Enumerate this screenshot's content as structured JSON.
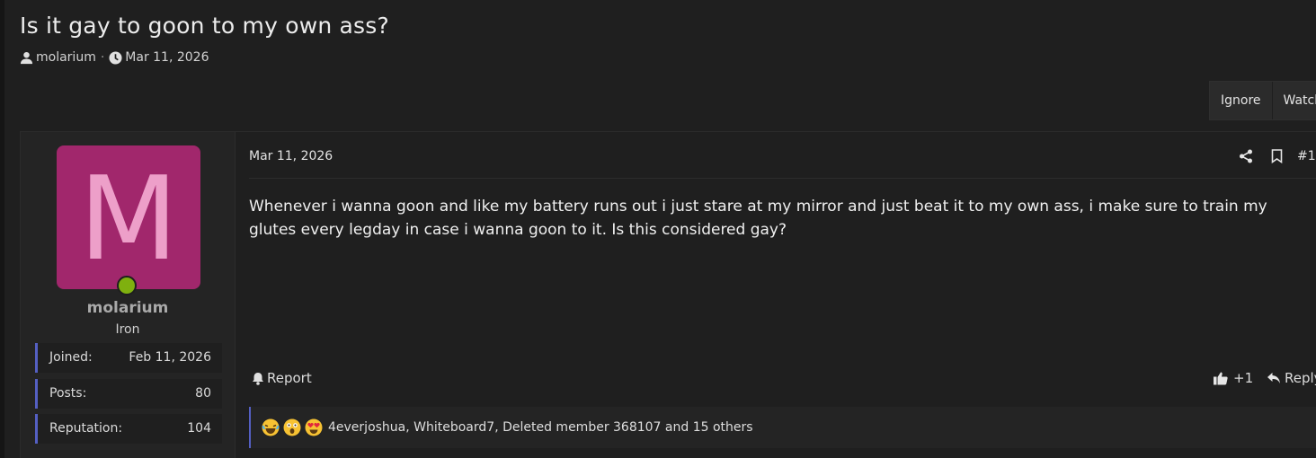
{
  "thread": {
    "title": "Is it gay to goon to my own ass?",
    "author": "molarium",
    "separator": "·",
    "date": "Mar 11, 2026",
    "actions": [
      "Ignore",
      "Watch"
    ]
  },
  "post": {
    "date": "Mar 11, 2026",
    "number": "#1",
    "body": "Whenever i wanna goon and like my battery runs out i just stare at my mirror and just beat it to my own ass, i make sure to train my glutes every legday in case i wanna goon to it. Is this considered gay?",
    "report_label": "Report",
    "like_count": "+1",
    "reply_label": "Reply",
    "reactions_text": "4everjoshua, Whiteboard7, Deleted member 368107 and 15 others",
    "reaction_icons": [
      "laughing-tears-emoji",
      "shocked-face-emoji",
      "heart-eyes-emoji"
    ]
  },
  "user": {
    "avatar_letter": "M",
    "avatar_bg": "#a1276c",
    "avatar_letter_color": "#ed9fc9",
    "online_color": "#7fb00f",
    "name": "molarium",
    "title": "Iron",
    "stats": [
      {
        "label": "Joined:",
        "value": "Feb 11, 2026"
      },
      {
        "label": "Posts:",
        "value": "80"
      },
      {
        "label": "Reputation:",
        "value": "104"
      }
    ]
  },
  "colors": {
    "accent": "#545fc2",
    "background": "#1f1f1f"
  }
}
